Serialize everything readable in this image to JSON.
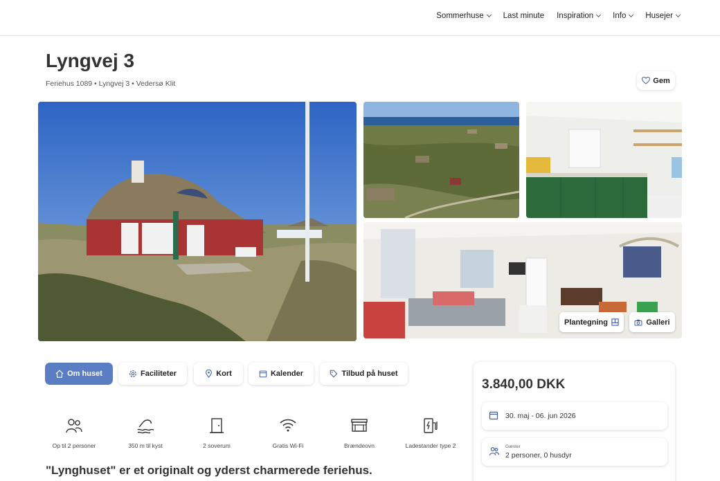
{
  "nav": {
    "items": [
      {
        "label": "Sommerhuse",
        "has_dropdown": true
      },
      {
        "label": "Last minute",
        "has_dropdown": false
      },
      {
        "label": "Inspiration",
        "has_dropdown": true
      },
      {
        "label": "Info",
        "has_dropdown": true
      },
      {
        "label": "Husejer",
        "has_dropdown": true
      }
    ]
  },
  "property": {
    "title": "Lyngvej 3",
    "subtitle": "Feriehus 1089 • Lyngvej 3 • Vedersø Klit",
    "save_label": "Gem"
  },
  "gallery": {
    "floorplan_label": "Plantegning",
    "gallery_label": "Galleri"
  },
  "tabs": [
    {
      "label": "Om huset",
      "icon": "home-icon",
      "active": true
    },
    {
      "label": "Faciliteter",
      "icon": "gear-icon",
      "active": false
    },
    {
      "label": "Kort",
      "icon": "map-pin-icon",
      "active": false
    },
    {
      "label": "Kalender",
      "icon": "calendar-icon",
      "active": false
    },
    {
      "label": "Tilbud på huset",
      "icon": "tag-icon",
      "active": false
    }
  ],
  "features": [
    {
      "label": "Op til 2 personer",
      "icon": "people-icon"
    },
    {
      "label": "350 m til kyst",
      "icon": "beach-icon"
    },
    {
      "label": "2 soverum",
      "icon": "door-icon"
    },
    {
      "label": "Gratis Wi-Fi",
      "icon": "wifi-icon"
    },
    {
      "label": "Brændeovn",
      "icon": "fireplace-icon"
    },
    {
      "label": "Ladestander type 2",
      "icon": "ev-charger-icon"
    }
  ],
  "description": {
    "heading": "\"Lynghuset\" er et originalt og yderst charmerede feriehus."
  },
  "booking": {
    "price": "3.840,00 DKK",
    "dates": "30. maj - 06. jun 2026",
    "guests_label": "Gæster",
    "guests_value": "2 personer, 0 husdyr"
  },
  "colors": {
    "accent": "#5b7dc4"
  }
}
